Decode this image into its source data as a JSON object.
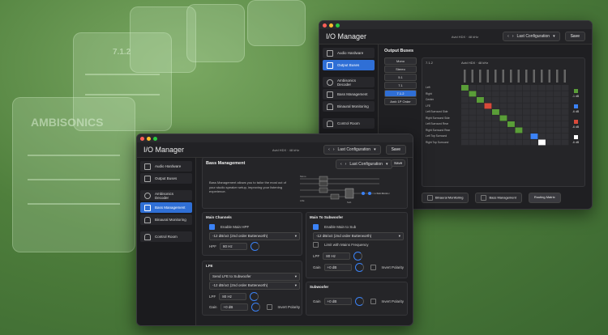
{
  "background": {
    "card_text_ambisonics": "AMBISONICS",
    "card_text_712": "7.1.2"
  },
  "win_back": {
    "title": "I/O Manager",
    "device": "Avid HDX · 48 kHz",
    "config_label": "Last Configuration",
    "save_label": "Save",
    "sidebar": [
      {
        "label": "Audio Hardware",
        "icon": "speaker-icon"
      },
      {
        "label": "Output Buses",
        "icon": "output-icon",
        "active": true
      },
      {
        "label": "Ambisonics Decoder",
        "icon": "ambisonics-icon"
      },
      {
        "label": "Bass Management",
        "icon": "bass-icon"
      },
      {
        "label": "Binaural Monitoring",
        "icon": "headphones-icon"
      },
      {
        "label": "Control Room",
        "icon": "headphones-icon"
      }
    ],
    "section_title": "Output Buses",
    "bus_list": [
      "Mono",
      "Stereo",
      "5.1",
      "7.1",
      "7.1.2",
      "Amb 1P Order"
    ],
    "matrix_header_left": "7.1.2",
    "matrix_header_right": "Avid HDX · 48 kHz",
    "matrix_rows": [
      "Left",
      "Right",
      "Center",
      "LFE",
      "Left Surround Side",
      "Right Surround Side",
      "Left Surround Rear",
      "Right Surround Rear",
      "Left Top Surround",
      "Right Top Surround"
    ],
    "level_labels": [
      "-1 dB",
      "-6 dB",
      "-6 dB",
      "-6 dB"
    ],
    "bottom_buttons": [
      "Binaural Monitoring",
      "Bass Management",
      "Routing Matrix"
    ]
  },
  "win_front": {
    "title": "I/O Manager",
    "device": "Avid HDX · 48 kHz",
    "config_label": "Last Configuration",
    "save_label": "Save",
    "sidebar": [
      {
        "label": "Audio Hardware",
        "icon": "speaker-icon"
      },
      {
        "label": "Output Buses",
        "icon": "output-icon"
      },
      {
        "label": "Ambisonics Decoder",
        "icon": "ambisonics-icon"
      },
      {
        "label": "Bass Management",
        "icon": "bass-icon",
        "active": true
      },
      {
        "label": "Binaural Monitoring",
        "icon": "headphones-icon"
      },
      {
        "label": "Control Room",
        "icon": "headphones-icon"
      }
    ],
    "section_title": "Bass Management",
    "description": "Bass Management allows you to tailor the most out of your studio speaker setup, improving your listening experience.",
    "diagram_labels": {
      "mono": "Mono",
      "lfe": "LFE",
      "sub": "Sub",
      "out": "+ Sub Monitor"
    },
    "main_channels": {
      "title": "Main Channels",
      "enable_label": "Enable Main HPF",
      "filter": "-12 dB/oct (2nd order Butterworth)",
      "hpf_label": "HPF",
      "hpf_value": "80 Hz"
    },
    "main_to_sub": {
      "title": "Main To Subwoofer",
      "enable_label": "Enable Main to Sub",
      "filter": "-12 dB/oct (2nd order Butterworth)",
      "limit_label": "Limit with Mains Frequency",
      "lpf_label": "LPF",
      "lpf_value": "80 Hz",
      "gain_label": "Gain",
      "gain_value": "+0 dB",
      "invert_label": "Invert Polarity"
    },
    "lfe": {
      "title": "LFE",
      "send_option": "Send LFE to Subwoofer",
      "filter": "-12 dB/oct (2nd order Butterworth)",
      "lpf_label": "LPF",
      "lpf_value": "80 Hz",
      "gain_label": "Gain",
      "gain_value": "+0 dB",
      "invert_label": "Invert Polarity"
    },
    "subwoofer": {
      "title": "Subwoofer",
      "gain_label": "Gain",
      "gain_value": "+0 dB",
      "invert_label": "Invert Polarity"
    }
  }
}
